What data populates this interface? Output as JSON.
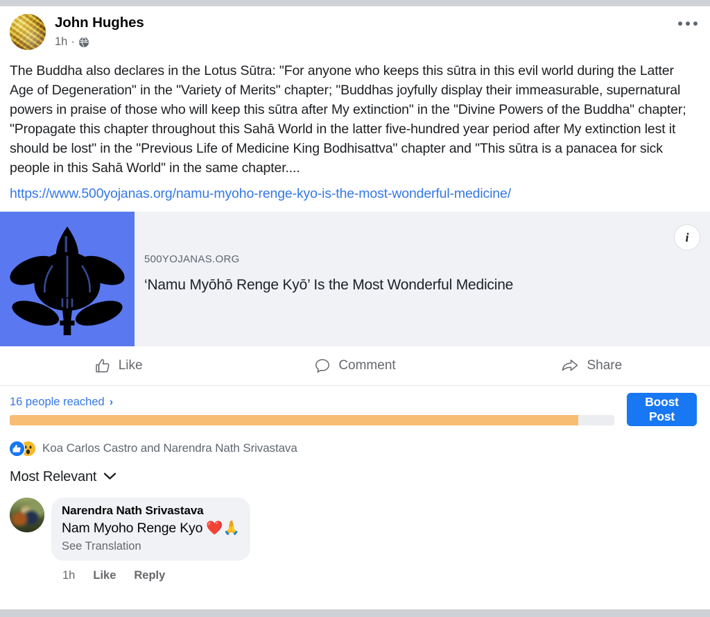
{
  "post": {
    "author": "John Hughes",
    "time": "1h",
    "separator": "·",
    "privacy_icon": "globe-icon",
    "more_icon": "ellipsis-icon",
    "body_text": "The Buddha also declares in the Lotus Sūtra: \"For anyone who keeps this sūtra in this evil world during the Latter Age of Degeneration\" in the \"Variety of Merits\" chapter; \"Buddhas joyfully display their immeasurable, supernatural powers in praise of those who will keep this sūtra after My extinction\" in the \"Divine Powers of the Buddha\" chapter; \"Propagate this chapter throughout this Sahā World in the latter five-hundred year period after My extinction lest it should be lost\" in the \"Previous Life of Medicine King Bodhisattva\" chapter and \"This sūtra is a panacea for sick people in this Sahā World\" in the same chapter....",
    "link_url": "https://www.500yojanas.org/namu-myoho-renge-kyo-is-the-most-wonderful-medicine/"
  },
  "link_preview": {
    "domain": "500YOJANAS.ORG",
    "title": "‘Namu Myōhō Renge Kyō’ Is the Most Wonderful Medicine",
    "info_badge": "i",
    "thumbnail_icon": "tachibana-kamon-crest-icon",
    "thumbnail_bg": "#5a78f0"
  },
  "actions": [
    {
      "label": "Like",
      "icon": "thumbs-up-icon",
      "name": "like-button"
    },
    {
      "label": "Comment",
      "icon": "comment-bubble-icon",
      "name": "comment-button"
    },
    {
      "label": "Share",
      "icon": "share-arrow-icon",
      "name": "share-button"
    }
  ],
  "reach": {
    "label": "16 people reached",
    "count": 16,
    "chevron": "›",
    "progress_percent": 94,
    "bar_color": "#f7bd73",
    "track_color": "#ebedf0",
    "boost_label": "Boost Post",
    "boost_color": "#1877f2"
  },
  "reactions": {
    "icons": [
      "like-reaction-icon",
      "wow-reaction-icon"
    ],
    "names": "Koa Carlos Castro and Narendra Nath Srivastava"
  },
  "sort": {
    "label": "Most Relevant",
    "chevron_icon": "chevron-down-icon"
  },
  "comment": {
    "author": "Narendra Nath Srivastava",
    "text": "Nam Myoho Renge Kyo ❤️🙏",
    "see_translation": "See Translation",
    "time": "1h",
    "like_label": "Like",
    "reply_label": "Reply"
  }
}
